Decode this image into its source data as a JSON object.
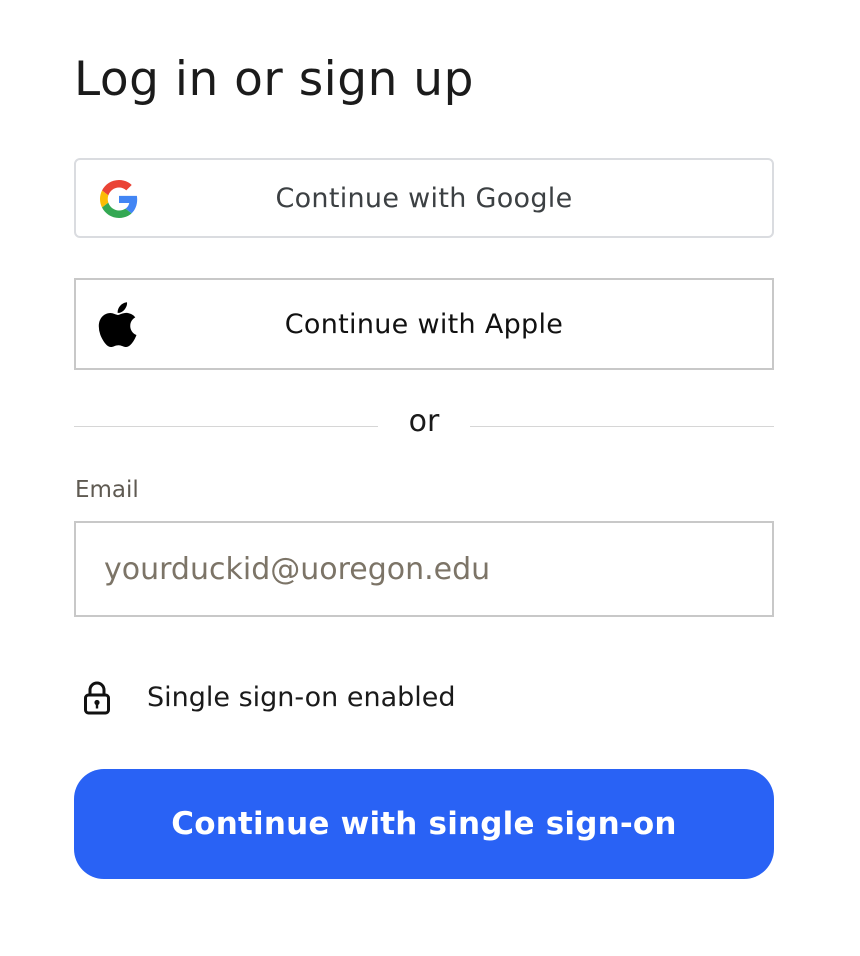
{
  "page": {
    "title": "Log in or sign up"
  },
  "google_button": {
    "label": "Continue with Google",
    "icon": "google-logo-icon"
  },
  "apple_button": {
    "label": "Continue with Apple",
    "icon": "apple-logo-icon"
  },
  "divider": {
    "text": "or"
  },
  "email": {
    "label": "Email",
    "value": "",
    "placeholder": "yourduckid@uoregon.edu"
  },
  "sso_status": {
    "icon": "lock-icon",
    "text": "Single sign-on enabled"
  },
  "sso_button": {
    "label": "Continue with single sign-on"
  },
  "colors": {
    "primary": "#2962f5",
    "google_blue": "#4285F4",
    "google_red": "#EA4335",
    "google_yellow": "#FBBC05",
    "google_green": "#34A853"
  }
}
